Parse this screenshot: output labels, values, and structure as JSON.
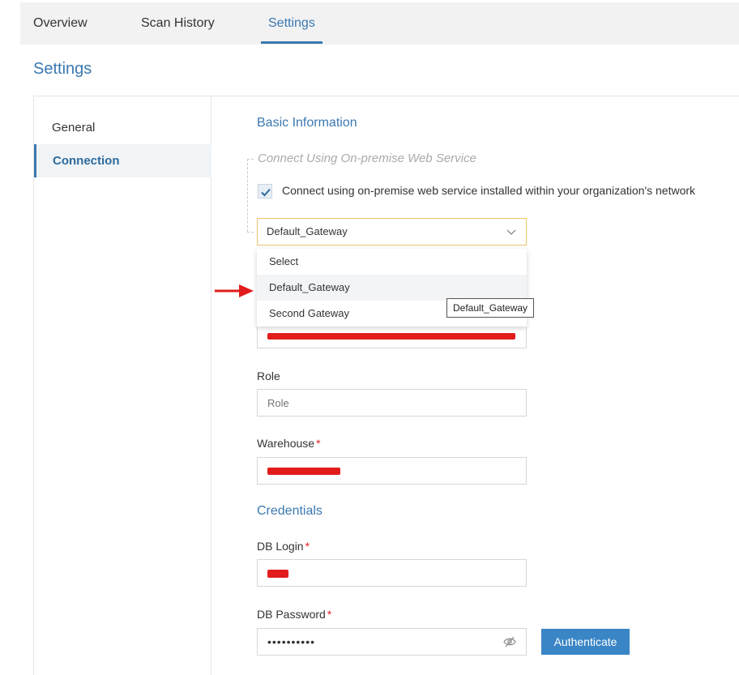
{
  "tabs": [
    {
      "label": "Overview"
    },
    {
      "label": "Scan History"
    },
    {
      "label": "Settings"
    }
  ],
  "page_title": "Settings",
  "sidebar": {
    "items": [
      {
        "label": "General"
      },
      {
        "label": "Connection"
      }
    ]
  },
  "basic_info": {
    "title": "Basic Information",
    "legend": "Connect Using On-premise Web Service",
    "checkbox_label": "Connect using on-premise web service installed within your organization's network",
    "checked": true
  },
  "gateway_select": {
    "value": "Default_Gateway",
    "options": [
      "Select",
      "Default_Gateway",
      "Second Gateway"
    ],
    "tooltip": "Default_Gateway"
  },
  "fields": {
    "role": {
      "label": "Role",
      "placeholder": "Role"
    },
    "warehouse": {
      "label": "Warehouse",
      "required_mark": "*"
    },
    "credentials_title": "Credentials",
    "db_login": {
      "label": "DB Login",
      "required_mark": "*"
    },
    "db_password": {
      "label": "DB Password",
      "required_mark": "*",
      "value": "••••••••••"
    }
  },
  "authenticate_label": "Authenticate",
  "colors": {
    "accent": "#3a78b0",
    "button": "#3a85c6",
    "required": "#e02020",
    "redaction": "#e21c1c"
  }
}
